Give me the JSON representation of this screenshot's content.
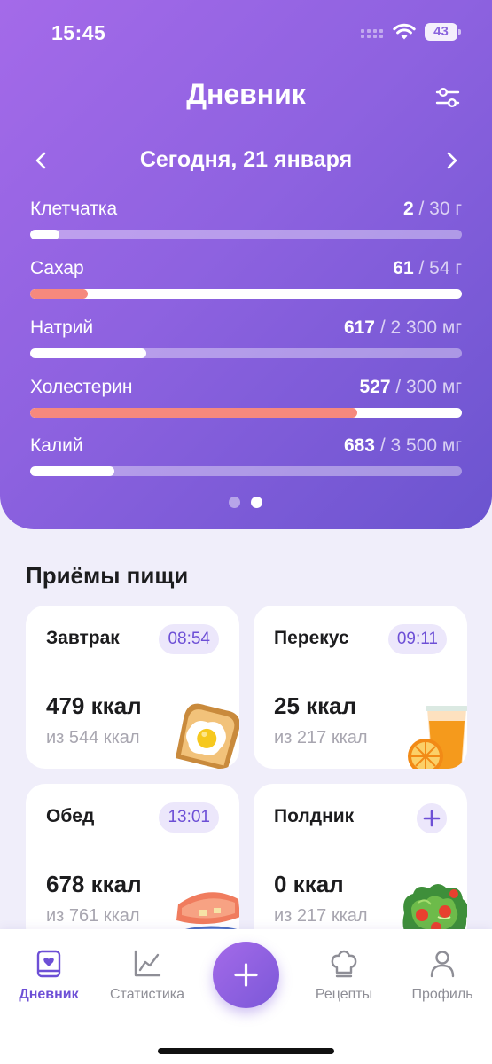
{
  "status": {
    "time": "15:45",
    "battery": "43"
  },
  "header": {
    "title": "Дневник",
    "date_label": "Сегодня,  21 января"
  },
  "nutrients": [
    {
      "name": "Клетчатка",
      "current": "2",
      "limit": " / 30 г",
      "progress": 0.067,
      "warn": false
    },
    {
      "name": "Сахар",
      "current": "61",
      "limit": " / 54 г",
      "progress": 0.133,
      "warn": true
    },
    {
      "name": "Натрий",
      "current": "617",
      "limit": " / 2 300 мг",
      "progress": 0.268,
      "warn": false
    },
    {
      "name": "Холестерин",
      "current": "527",
      "limit": " / 300 мг",
      "progress": 0.757,
      "warn": true
    },
    {
      "name": "Калий",
      "current": "683",
      "limit": " / 3 500 мг",
      "progress": 0.195,
      "warn": false
    }
  ],
  "pager": {
    "pages": 2,
    "active": 2
  },
  "meals_section": {
    "title": "Приёмы пищи"
  },
  "meals": [
    {
      "name": "Завтрак",
      "time": "08:54",
      "kcal": "479 ккал",
      "of": "из 544 ккал",
      "icon": "toast-egg-icon"
    },
    {
      "name": "Перекус",
      "time": "09:11",
      "kcal": "25 ккал",
      "of": "из 217 ккал",
      "icon": "orange-juice-icon"
    },
    {
      "name": "Обед",
      "time": "13:01",
      "kcal": "678 ккал",
      "of": "из 761 ккал",
      "icon": "dish-icon"
    },
    {
      "name": "Полдник",
      "time": null,
      "kcal": "0 ккал",
      "of": "из 217 ккал",
      "icon": "salad-icon"
    }
  ],
  "tabs": [
    {
      "label": "Дневник",
      "icon": "diary-icon",
      "active": true
    },
    {
      "label": "Статистика",
      "icon": "chart-icon",
      "active": false
    },
    {
      "label": "Рецепты",
      "icon": "chef-hat-icon",
      "active": false
    },
    {
      "label": "Профиль",
      "icon": "profile-icon",
      "active": false
    }
  ],
  "colors": {
    "accent": "#6d4fd6",
    "warn": "#f6897d",
    "gradient_start": "#a46ae9",
    "gradient_end": "#6b54cf"
  }
}
